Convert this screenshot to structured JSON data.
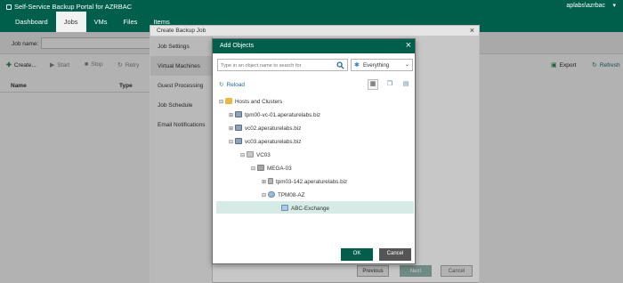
{
  "app": {
    "title": "Self-Service Backup Portal for AZRBAC",
    "user": "aplabs\\azrbac",
    "tabs": [
      "Dashboard",
      "Jobs",
      "VMs",
      "Files",
      "Items"
    ]
  },
  "jobs_page": {
    "job_name_label": "Job name:",
    "toolbar": {
      "create": "Create...",
      "start": "Start",
      "stop": "Stop",
      "retry": "Retry",
      "export": "Export",
      "refresh": "Refresh"
    },
    "columns": [
      "Name",
      "Type"
    ]
  },
  "wizard": {
    "title": "Create Backup Job",
    "steps": [
      "Job Settings",
      "Virtual Machines",
      "Guest Processing",
      "Job Schedule",
      "Email Notifications"
    ],
    "active_step": "Virtual Machines",
    "buttons": {
      "previous": "Previous",
      "next": "Next",
      "cancel": "Cancel"
    }
  },
  "dialog": {
    "title": "Add Objects",
    "search_placeholder": "Type in an object name to search for",
    "filter_value": "Everything",
    "reload": "Reload",
    "tree": [
      {
        "label": "Hosts and Clusters",
        "icon": "folder-icon"
      },
      {
        "label": "tpm00-vc-01.aperaturelabs.biz",
        "icon": "vcenter-icon"
      },
      {
        "label": "vc02.aperaturelabs.biz",
        "icon": "vcenter-icon"
      },
      {
        "label": "vc03.aperaturelabs.biz",
        "icon": "vcenter-icon"
      },
      {
        "label": "VC03",
        "icon": "datacenter-icon"
      },
      {
        "label": "MEGA-03",
        "icon": "cluster-icon"
      },
      {
        "label": "tpm03-142.aperaturelabs.biz",
        "icon": "host-icon"
      },
      {
        "label": "TPM08-AZ",
        "icon": "resource-pool-icon"
      },
      {
        "label": "ABC-Exchange",
        "icon": "vapp-icon",
        "selected": true
      }
    ],
    "ok": "OK",
    "cancel": "Cancel"
  },
  "colors": {
    "brand_green": "#005f4b",
    "selection": "#d5ebe5",
    "link_blue": "#1f6f8b"
  }
}
